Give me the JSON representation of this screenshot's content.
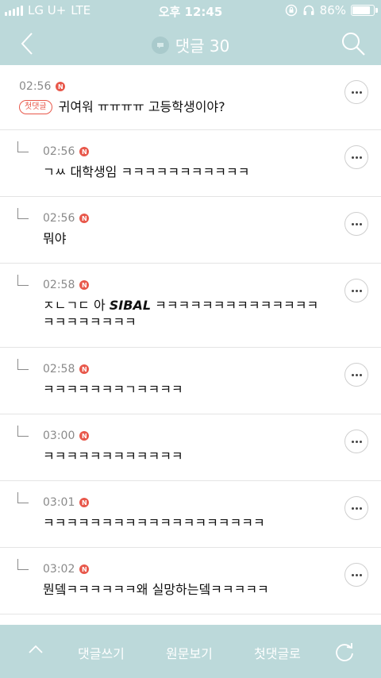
{
  "status_bar": {
    "carrier": "LG U+",
    "network": "LTE",
    "time": "오후 12:45",
    "battery": "86%",
    "battery_level": 0.86
  },
  "nav": {
    "title": "댓글 30",
    "back_icon": "chevron-left-icon",
    "search_icon": "search-icon"
  },
  "comments": [
    {
      "time": "02:56",
      "first_badge": "첫댓글",
      "text": "귀여워 ㅠㅠㅠㅠ 고등학생이야?"
    },
    {
      "time": "02:56",
      "text": "ㄱㅆ 대학생임 ㅋㅋㅋㅋㅋㅋㅋㅋㅋㅋㅋ"
    },
    {
      "time": "02:56",
      "text": "뭐야"
    },
    {
      "time": "02:58",
      "text_before": "ㅈㄴㄱㄷ 아 ",
      "text_em": "SIBAL",
      "text_after": " ㅋㅋㅋㅋㅋㅋㅋㅋㅋㅋㅋㅋㅋㅋㅋㅋㅋㅋㅋㅋㅋㅋ"
    },
    {
      "time": "02:58",
      "text": "ㅋㅋㅋㅋㅋㅋㅋㄱㅋㅋㅋㅋ"
    },
    {
      "time": "03:00",
      "text": "ㅋㅋㅋㅋㅋㅋㅋㅋㅋㅋㅋㅋ"
    },
    {
      "time": "03:01",
      "text": "ㅋㅋㅋㅋㅋㅋㅋㅋㅋㅋㅋㅋㅋㅋㅋㅋㅋㅋㅋ"
    },
    {
      "time": "03:02",
      "text": "뭔뎈ㅋㅋㅋㅋㅋㅋ왜 실망하는뎈ㅋㅋㅋㅋㅋ"
    }
  ],
  "new_badge": "N",
  "bottom": {
    "write": "댓글쓰기",
    "view_original": "원문보기",
    "first_comment": "첫댓글로"
  },
  "colors": {
    "header_bg": "#bcd9da",
    "accent_red": "#e8584b"
  }
}
